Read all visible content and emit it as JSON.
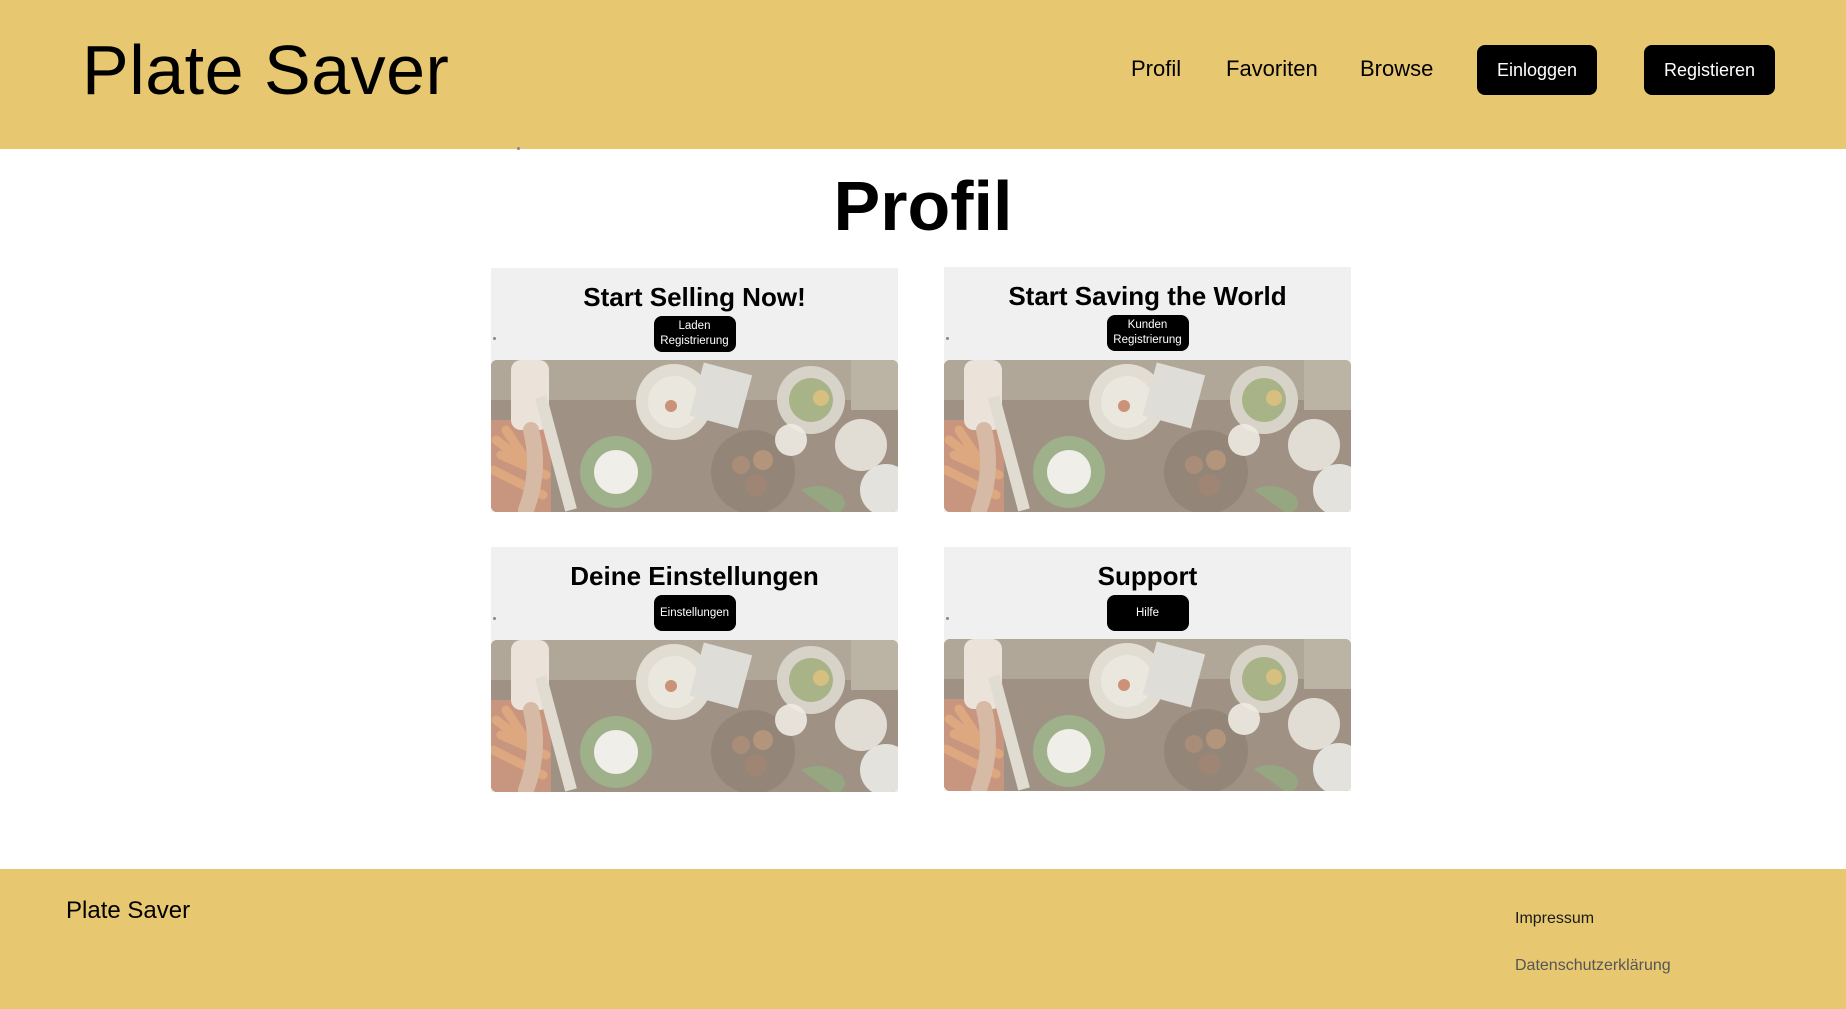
{
  "header": {
    "logo": "Plate Saver",
    "nav": [
      {
        "label": "Profil"
      },
      {
        "label": "Favoriten"
      },
      {
        "label": "Browse"
      }
    ],
    "login_label": "Einloggen",
    "register_label": "Registieren"
  },
  "page": {
    "title": "Profil"
  },
  "cards": [
    {
      "title": "Start Selling Now!",
      "button": "Laden Registrierung"
    },
    {
      "title": "Start Saving the World",
      "button": "Kunden Registrierung"
    },
    {
      "title": "Deine Einstellungen",
      "button": "Einstellungen"
    },
    {
      "title": "Support",
      "button": "Hilfe"
    }
  ],
  "footer": {
    "logo": "Plate Saver",
    "links": [
      {
        "label": "Impressum"
      },
      {
        "label": "Datenschutzerklärung"
      }
    ]
  },
  "colors": {
    "brand_yellow": "#e8c771",
    "button_bg": "#000000",
    "card_bg": "#f0f0f0"
  }
}
